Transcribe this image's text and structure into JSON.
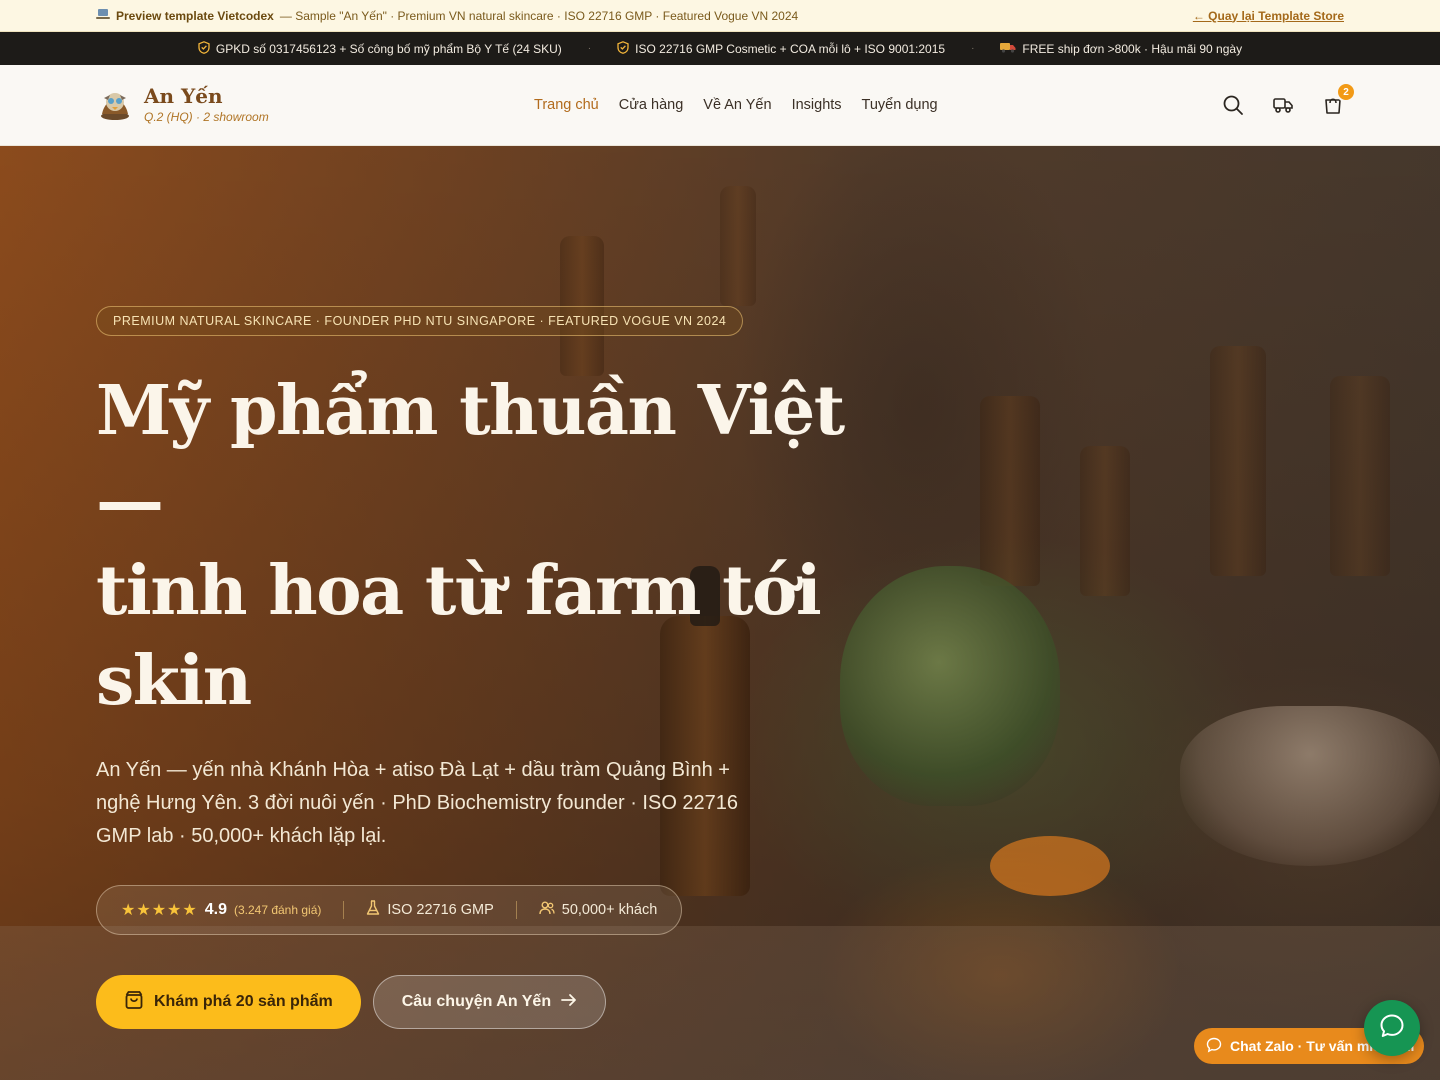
{
  "preview_bar": {
    "icon": "laptop-icon",
    "brand": "Preview template Vietcodex",
    "text": "— Sample \"An Yến\" · Premium VN natural skincare · ISO 22716 GMP · Featured Vogue VN 2024",
    "back_link": "← Quay lại Template Store"
  },
  "trust_bar": {
    "items": [
      {
        "icon": "shield-check-icon",
        "text": "GPKD số 0317456123 + Số công bố mỹ phẩm Bộ Y Tế (24 SKU)"
      },
      {
        "icon": "shield-check-icon",
        "text": "ISO 22716 GMP Cosmetic + COA mỗi lô + ISO 9001:2015"
      },
      {
        "icon": "truck-emoji-icon",
        "text": "FREE ship đơn >800k · Hậu mãi 90 ngày"
      }
    ],
    "separator": "·"
  },
  "header": {
    "logo_name": "An Yến",
    "logo_sub": "Q.2 (HQ) · 2 showroom",
    "nav": [
      "Trang chủ",
      "Cửa hàng",
      "Về An Yến",
      "Insights",
      "Tuyển dụng"
    ],
    "active_nav": "Trang chủ",
    "cart_count": "2",
    "colors": {
      "accent": "#b26b1c",
      "badge": "#f29a16"
    }
  },
  "hero": {
    "eyebrow": "PREMIUM NATURAL SKINCARE · FOUNDER PHD NTU SINGAPORE · FEATURED VOGUE VN 2024",
    "headline_lines": [
      "Mỹ phẩm thuần Việt —",
      "tinh hoa từ farm tới",
      "skin"
    ],
    "lede": "An Yến — yến nhà Khánh Hòa + atiso Đà Lạt + dầu tràm Quảng Bình + nghệ Hưng Yên. 3 đời nuôi yến · PhD Biochemistry founder · ISO 22716 GMP lab · 50,000+ khách lặp lại.",
    "stats": {
      "stars": "★★★★★",
      "rating": "4.9",
      "rating_count": "(3.247 đánh giá)",
      "iso": "ISO 22716 GMP",
      "customers": "50,000+ khách"
    },
    "cta_primary": "Khám phá 20 sản phẩm",
    "cta_secondary": "Câu chuyện An Yến",
    "colors": {
      "cta_primary": "#fcbc1b",
      "stars": "#f8c33a"
    }
  },
  "chat": {
    "pill_label": "Chat Zalo · Tư vấn miễn phí",
    "colors": {
      "pill": "#e88a1c",
      "fab": "#169553"
    }
  }
}
